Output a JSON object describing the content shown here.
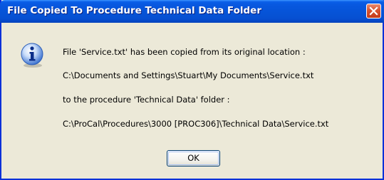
{
  "window": {
    "title": "File Copied To Procedure Technical Data Folder"
  },
  "title_bar": {
    "close_icon": "close-icon"
  },
  "dialog": {
    "icon": "info-icon",
    "message_lines": [
      "File 'Service.txt' has been copied from its original location :",
      "C:\\Documents and Settings\\Stuart\\My Documents\\Service.txt",
      "to the procedure 'Technical Data' folder :",
      "C:\\ProCal\\Procedures\\3000 [PROC306]\\Technical Data\\Service.txt"
    ],
    "ok_label": "OK"
  },
  "colors": {
    "titlebar": "#0654D8",
    "dialog_background": "#ECE9D8",
    "close_button": "#D8532F",
    "text": "#000000"
  }
}
